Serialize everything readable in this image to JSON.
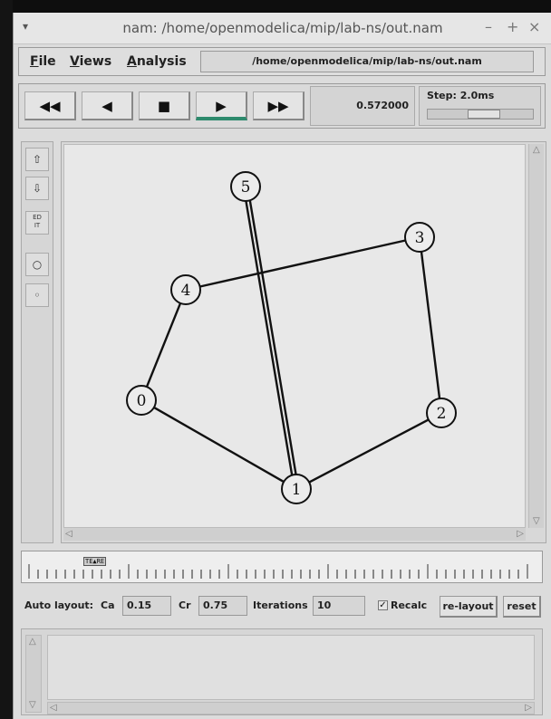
{
  "window": {
    "title": "nam: /home/openmodelica/mip/lab-ns/out.nam",
    "menu_glyph": "▾",
    "minimize": "–",
    "maximize": "+",
    "close": "×"
  },
  "menubar": {
    "file": "File",
    "views": "Views",
    "analysis": "Analysis",
    "path": "/home/openmodelica/mip/lab-ns/out.nam"
  },
  "controls": {
    "rewind": "◀◀",
    "back": "◀",
    "stop": "■",
    "play": "▶",
    "forward": "▶▶",
    "time": "0.572000",
    "step_label": "Step: 2.0ms"
  },
  "tools": {
    "up": "⇧",
    "down": "⇩",
    "edit": "ED\nIT",
    "circle": "○",
    "dot": "◦"
  },
  "topology": {
    "nodes": [
      {
        "id": "0",
        "label": "0"
      },
      {
        "id": "1",
        "label": "1"
      },
      {
        "id": "2",
        "label": "2"
      },
      {
        "id": "3",
        "label": "3"
      },
      {
        "id": "4",
        "label": "4"
      },
      {
        "id": "5",
        "label": "5"
      }
    ],
    "links": [
      {
        "from": "0",
        "to": "4"
      },
      {
        "from": "0",
        "to": "1"
      },
      {
        "from": "1",
        "to": "2"
      },
      {
        "from": "2",
        "to": "3"
      },
      {
        "from": "3",
        "to": "4"
      },
      {
        "from": "5",
        "to": "1",
        "duplex": true
      }
    ]
  },
  "timeline": {
    "marker": "TE▲RE"
  },
  "layout": {
    "auto_label": "Auto layout:",
    "ca_label": "Ca",
    "ca_value": "0.15",
    "cr_label": "Cr",
    "cr_value": "0.75",
    "iter_label": "Iterations",
    "iter_value": "10",
    "recalc_label": "Recalc",
    "recalc_checked": true,
    "relayout": "re-layout",
    "reset": "reset"
  }
}
